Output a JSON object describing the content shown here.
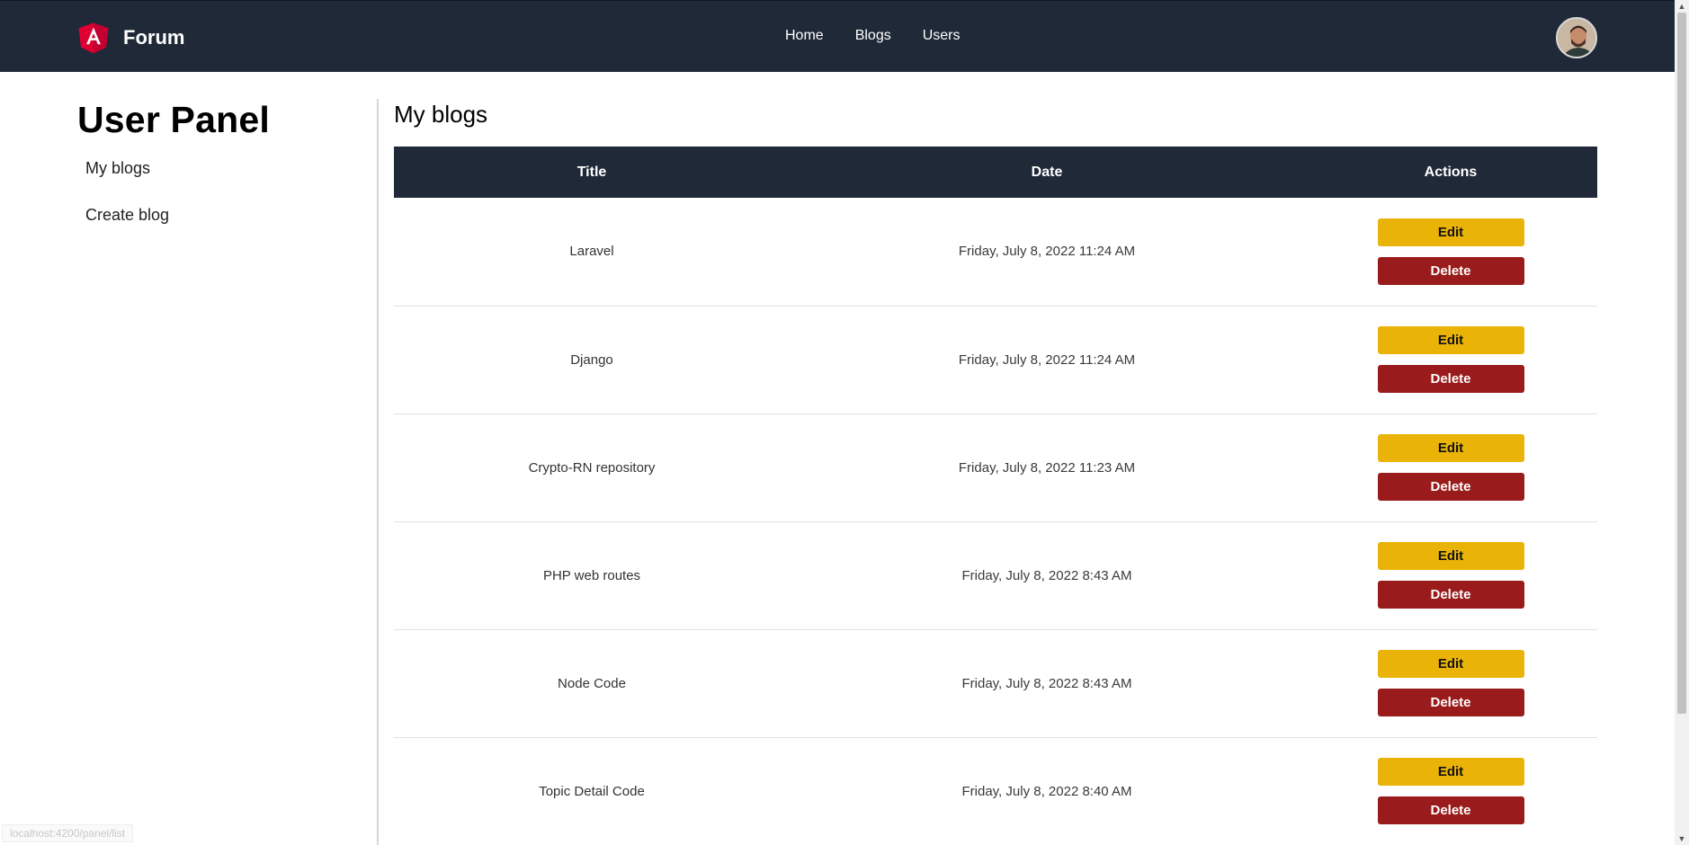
{
  "navbar": {
    "brand_name": "Forum",
    "logo_icon": "angular-logo-icon",
    "links": [
      "Home",
      "Blogs",
      "Users"
    ],
    "avatar": "user-avatar",
    "bg_color": "#1f2937"
  },
  "sidebar": {
    "title": "User Panel",
    "items": [
      {
        "label": "My blogs"
      },
      {
        "label": "Create blog"
      }
    ]
  },
  "main": {
    "title": "My blogs",
    "table": {
      "headers": [
        "Title",
        "Date",
        "Actions"
      ],
      "rows": [
        {
          "title": "Laravel",
          "date": "Friday, July 8, 2022 11:24 AM"
        },
        {
          "title": "Django",
          "date": "Friday, July 8, 2022 11:24 AM"
        },
        {
          "title": "Crypto-RN repository",
          "date": "Friday, July 8, 2022 11:23 AM"
        },
        {
          "title": "PHP web routes",
          "date": "Friday, July 8, 2022 8:43 AM"
        },
        {
          "title": "Node Code",
          "date": "Friday, July 8, 2022 8:43 AM"
        },
        {
          "title": "Topic Detail Code",
          "date": "Friday, July 8, 2022 8:40 AM"
        }
      ],
      "edit_label": "Edit",
      "delete_label": "Delete"
    }
  },
  "status_url": "localhost:4200/panel/list",
  "colors": {
    "edit": "#eab308",
    "delete": "#991b1b",
    "header": "#1f2937"
  }
}
